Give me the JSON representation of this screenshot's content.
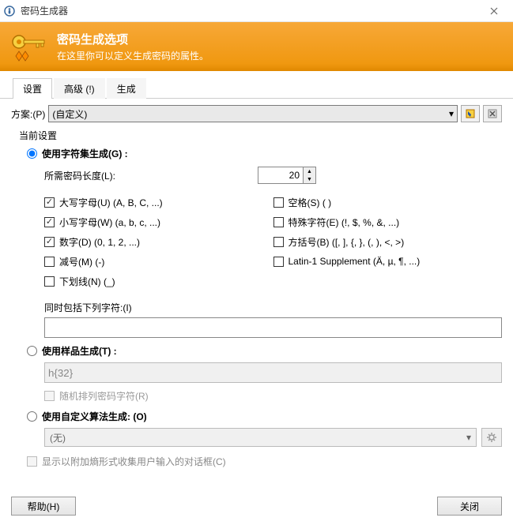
{
  "window": {
    "title": "密码生成器"
  },
  "banner": {
    "heading": "密码生成选项",
    "sub": "在这里你可以定义生成密码的属性。"
  },
  "tabs": {
    "settings": "设置",
    "advanced": "高级 (!)",
    "generate": "生成"
  },
  "scheme": {
    "label": "方案:(P)",
    "value": "(自定义)"
  },
  "group": {
    "title": "当前设置"
  },
  "radio": {
    "charset": "使用字符集生成(G) :",
    "pattern": "使用样品生成(T) :",
    "algorithm": "使用自定义算法生成: (O)"
  },
  "length": {
    "label": "所需密码长度(L):",
    "value": "20"
  },
  "checks_left": [
    {
      "label": "大写字母(U)  (A, B, C, ...)",
      "checked": true
    },
    {
      "label": "小写字母(W)  (a, b, c, ...)",
      "checked": true
    },
    {
      "label": "数字(D)  (0, 1, 2, ...)",
      "checked": true
    },
    {
      "label": "减号(M)  (-)",
      "checked": false
    },
    {
      "label": "下划线(N)  (_)",
      "checked": false
    }
  ],
  "checks_right": [
    {
      "label": "空格(S)  ( )",
      "checked": false
    },
    {
      "label": "特殊字符(E)  (!, $, %, &, ...)",
      "checked": false
    },
    {
      "label": "方括号(B)  ([, ], {, }, (, ), <, >)",
      "checked": false
    },
    {
      "label": "Latin-1 Supplement  (Ä, µ, ¶, ...)",
      "checked": false
    }
  ],
  "also_include": {
    "label": "同时包括下列字符:(I)",
    "value": ""
  },
  "pattern": {
    "value": "h{32}",
    "shuffle_label": "随机排列密码字符(R)"
  },
  "algorithm": {
    "value": "(无)"
  },
  "entropy": {
    "label": "显示以附加熵形式收集用户输入的对话框(C)"
  },
  "footer": {
    "help": "帮助(H)",
    "close": "关闭"
  }
}
